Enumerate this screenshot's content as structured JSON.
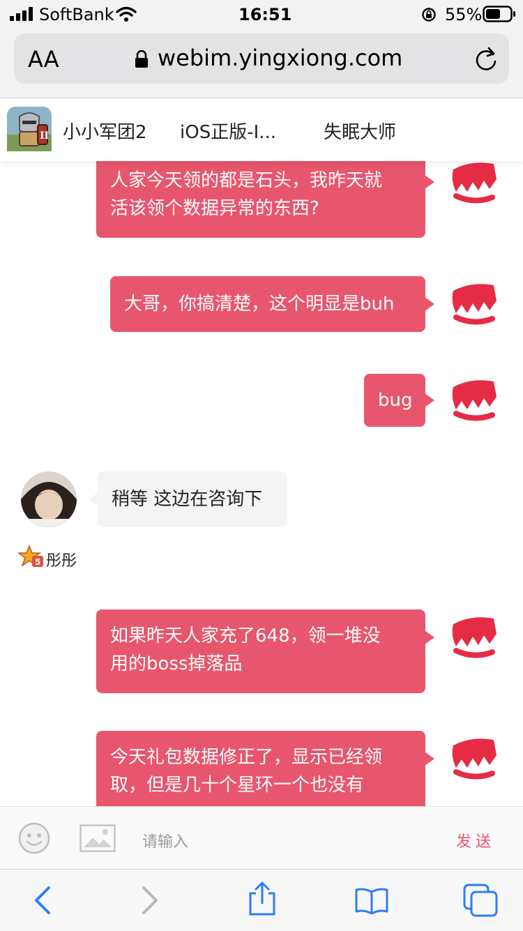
{
  "status": {
    "carrier": "SoftBank",
    "time": "16:51",
    "battery": "55%"
  },
  "browser": {
    "text_size_label": "AA",
    "url": "webim.yingxiong.com"
  },
  "tabs": [
    {
      "label": "小小军团2"
    },
    {
      "label": "iOS正版-I..."
    },
    {
      "label": "失眠大师"
    }
  ],
  "messages": [
    {
      "side": "mine",
      "lines": [
        "人家今天领的都是石头，我昨天就",
        "活该领个数据异常的东西?"
      ]
    },
    {
      "side": "mine",
      "lines": [
        "大哥，你搞清楚，这个明显是buh"
      ]
    },
    {
      "side": "mine",
      "lines": [
        "bug"
      ]
    },
    {
      "side": "theirs",
      "lines": [
        "稍等 这边在咨询下"
      ],
      "sender": "彤彤"
    },
    {
      "side": "mine",
      "lines": [
        "如果昨天人家充了648，领一堆没",
        "用的boss掉落品"
      ]
    },
    {
      "side": "mine",
      "lines": [
        "今天礼包数据修正了，显示已经领",
        "取，但是几十个星环一个也没有"
      ]
    }
  ],
  "input": {
    "placeholder": "请输入",
    "send_label": "发送"
  },
  "colors": {
    "accent": "#e8566d",
    "ios_blue": "#2f7cf6"
  },
  "icons": {
    "status": [
      "signal-icon",
      "wifi-icon",
      "orientation-lock-icon",
      "battery-icon"
    ],
    "input_bar": [
      "emoji-icon",
      "image-icon"
    ],
    "toolbar": [
      "back-icon",
      "forward-icon",
      "share-icon",
      "bookmarks-icon",
      "tabs-icon"
    ]
  }
}
